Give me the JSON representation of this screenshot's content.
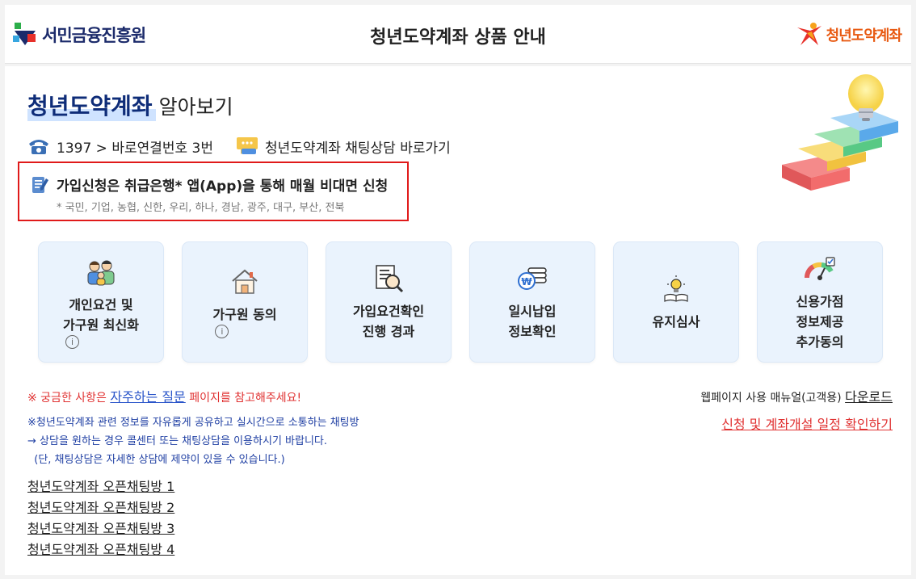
{
  "header": {
    "org_logo_text": "서민금융진흥원",
    "title": "청년도약계좌 상품 안내",
    "brand_logo_text": "청년도약계좌"
  },
  "intro": {
    "title_highlight": "청년도약계좌",
    "title_rest": "알아보기"
  },
  "contact": {
    "phone_text": "1397 > 바로연결번호 3번",
    "chat_link": "청년도약계좌 채팅상담 바로가기"
  },
  "notice": {
    "main": "가입신청은 취급은행* 앱(App)을 통해 매월 비대면 신청",
    "banks": "* 국민, 기업, 농협, 신한, 우리, 하나, 경남, 광주, 대구, 부산, 전북"
  },
  "cards": [
    {
      "line1": "개인요건 및",
      "line2": "가구원 최신화",
      "line3": "",
      "icon": "family-icon",
      "info": true
    },
    {
      "line1": "가구원 동의",
      "line2": "",
      "line3": "",
      "icon": "house-icon",
      "info": true
    },
    {
      "line1": "가입요건확인",
      "line2": "진행 경과",
      "line3": "",
      "icon": "document-search-icon",
      "info": false
    },
    {
      "line1": "일시납입",
      "line2": "정보확인",
      "line3": "",
      "icon": "coins-icon",
      "info": false
    },
    {
      "line1": "유지심사",
      "line2": "",
      "line3": "",
      "icon": "lightbulb-book-icon",
      "info": false
    },
    {
      "line1": "신용가점",
      "line2": "정보제공",
      "line3": "추가동의",
      "icon": "credit-gauge-icon",
      "info": false
    }
  ],
  "faq": {
    "prefix": "※ 궁금한 사항은 ",
    "link": "자주하는 질문",
    "suffix": " 페이지를 참고해주세요!"
  },
  "manual": {
    "prefix": "웹페이지 사용 매뉴얼(고객용) ",
    "link": "다운로드"
  },
  "schedule_link": "신청 및 계좌개설 일정 확인하기",
  "chat_info": {
    "line1": "※청년도약계좌 관련 정보를 자유롭게 공유하고 실시간으로 소통하는 채팅방",
    "line2": "→ 상담을 원하는 경우 콜센터 또는 채팅상담을 이용하시기 바랍니다.",
    "line3": "  (단, 채팅상담은 자세한 상담에 제약이 있을 수 있습니다.)"
  },
  "open_chat_rooms": [
    "청년도약계좌 오픈채팅방 1",
    "청년도약계좌 오픈채팅방 2",
    "청년도약계좌 오픈채팅방 3",
    "청년도약계좌 오픈채팅방 4"
  ],
  "colors": {
    "title_navy": "#0e2c78",
    "accent_red": "#e01a1a",
    "link_blue": "#2a55c9",
    "card_bg": "#eaf3fd",
    "brand_orange": "#e85a12"
  }
}
